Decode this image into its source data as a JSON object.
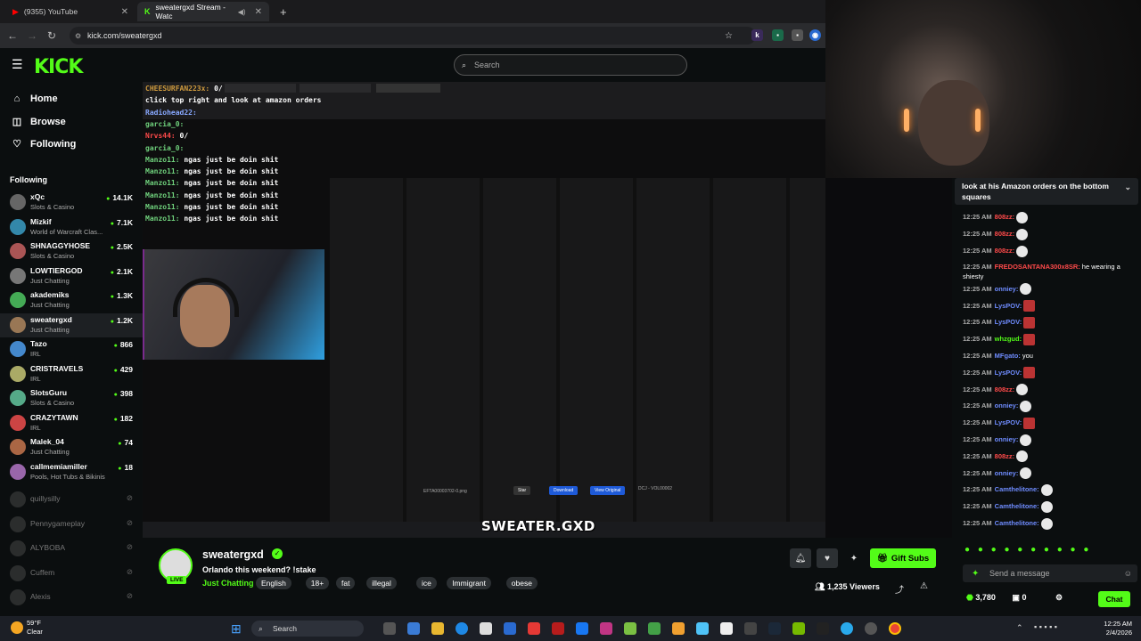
{
  "browser": {
    "tabs": [
      {
        "title": "(9355) YouTube"
      },
      {
        "title": "sweatergxd Stream - Watc"
      }
    ],
    "url": "kick.com/sweatergxd"
  },
  "header": {
    "logo": "KICK",
    "search_placeholder": "Search"
  },
  "sidebar": {
    "nav": [
      {
        "label": "Home"
      },
      {
        "label": "Browse"
      },
      {
        "label": "Following"
      }
    ],
    "following_title": "Following",
    "channels": [
      {
        "name": "xQc",
        "category": "Slots & Casino",
        "viewers": "14.1K"
      },
      {
        "name": "Mizkif",
        "category": "World of Warcraft Clas...",
        "viewers": "7.1K"
      },
      {
        "name": "SHNAGGYHOSE",
        "category": "Slots & Casino",
        "viewers": "2.5K"
      },
      {
        "name": "LOWTIERGOD",
        "category": "Just Chatting",
        "viewers": "2.1K"
      },
      {
        "name": "akademiks",
        "category": "Just Chatting",
        "viewers": "1.3K"
      },
      {
        "name": "sweatergxd",
        "category": "Just Chatting",
        "viewers": "1.2K"
      },
      {
        "name": "Tazo",
        "category": "IRL",
        "viewers": "866"
      },
      {
        "name": "CRISTRAVELS",
        "category": "IRL",
        "viewers": "429"
      },
      {
        "name": "SlotsGuru",
        "category": "Slots & Casino",
        "viewers": "398"
      },
      {
        "name": "CRAZYTAWN",
        "category": "IRL",
        "viewers": "182"
      },
      {
        "name": "Malek_04",
        "category": "Just Chatting",
        "viewers": "74"
      },
      {
        "name": "callmemiamiller",
        "category": "Pools, Hot Tubs & Bikinis",
        "viewers": "18"
      }
    ],
    "offline_channels": [
      {
        "name": "quillysilly"
      },
      {
        "name": "Pennygameplay"
      },
      {
        "name": "ALYBOBA"
      },
      {
        "name": "Cuffem"
      },
      {
        "name": "Alexis"
      }
    ]
  },
  "video": {
    "overlay_chat": [
      {
        "user": "CHEESURFAN223x:",
        "text": "0/"
      },
      {
        "user": "",
        "text": "click top right and look at amazon orders"
      },
      {
        "user": "Radiohead22:",
        "text": ""
      },
      {
        "user": "garcia_0:",
        "text": ""
      },
      {
        "user": "Nrvs44:",
        "text": "0/"
      },
      {
        "user": "garcia_0:",
        "text": ""
      },
      {
        "user": "Manzo11:",
        "text": "ngas just be doin shit"
      },
      {
        "user": "Manzo11:",
        "text": "ngas just be doin shit"
      },
      {
        "user": "Manzo11:",
        "text": "ngas just be doin shit"
      },
      {
        "user": "Manzo11:",
        "text": "ngas just be doin shit"
      },
      {
        "user": "Manzo11:",
        "text": "ngas just be doin shit"
      },
      {
        "user": "Manzo11:",
        "text": "ngas just be doin shit"
      }
    ],
    "inner_file": "EFTA00003702-0.png",
    "inner_buttons": [
      "Star",
      "Download",
      "View Original"
    ],
    "inner_code": "DCJ - VOL00002",
    "brand_text": "SWEATER.GXD"
  },
  "chat": {
    "pinned": "look at his Amazon orders on the bottom squares",
    "messages": [
      {
        "time": "12:25 AM",
        "user": "808zz:",
        "text": "",
        "color": "#ff4a4a"
      },
      {
        "time": "12:25 AM",
        "user": "808zz:",
        "text": "",
        "color": "#ff4a4a"
      },
      {
        "time": "12:25 AM",
        "user": "808zz:",
        "text": "",
        "color": "#ff4a4a"
      },
      {
        "time": "12:25 AM",
        "user": "FREDOSANTANA300x8SR:",
        "text": "he wearing a shiesty",
        "color": "#ff4a4a"
      },
      {
        "time": "12:25 AM",
        "user": "onniey:",
        "text": "",
        "color": "#6f8cff"
      },
      {
        "time": "12:25 AM",
        "user": "LysPOV:",
        "text": "",
        "color": "#6f8cff"
      },
      {
        "time": "12:25 AM",
        "user": "LysPOV:",
        "text": "",
        "color": "#6f8cff"
      },
      {
        "time": "12:25 AM",
        "user": "whzgud:",
        "text": "",
        "color": "#53fc18"
      },
      {
        "time": "12:25 AM",
        "user": "MFgato:",
        "text": "you",
        "color": "#6f8cff"
      },
      {
        "time": "12:25 AM",
        "user": "LysPOV:",
        "text": "",
        "color": "#6f8cff"
      },
      {
        "time": "12:25 AM",
        "user": "808zz:",
        "text": "",
        "color": "#ff4a4a"
      },
      {
        "time": "12:25 AM",
        "user": "onniey:",
        "text": "",
        "color": "#6f8cff"
      },
      {
        "time": "12:25 AM",
        "user": "LysPOV:",
        "text": "",
        "color": "#6f8cff"
      },
      {
        "time": "12:25 AM",
        "user": "onniey:",
        "text": "",
        "color": "#6f8cff"
      },
      {
        "time": "12:25 AM",
        "user": "808zz:",
        "text": "",
        "color": "#ff4a4a"
      },
      {
        "time": "12:25 AM",
        "user": "onniey:",
        "text": "",
        "color": "#6f8cff"
      },
      {
        "time": "12:25 AM",
        "user": "Camthelitone:",
        "text": "",
        "color": "#6f8cff"
      },
      {
        "time": "12:25 AM",
        "user": "Camthelitone:",
        "text": "",
        "color": "#6f8cff"
      },
      {
        "time": "12:25 AM",
        "user": "Camthelitone:",
        "text": "",
        "color": "#6f8cff"
      }
    ],
    "send_placeholder": "Send a message",
    "points": "3,780",
    "count": "0",
    "chat_button": "Chat"
  },
  "stream": {
    "streamer": "sweatergxd",
    "title": "Orlando this weekend? !stake",
    "category": "Just Chatting",
    "tags": [
      "English",
      "18+",
      "fat",
      "illegal",
      "ice",
      "Immigrant",
      "obese"
    ],
    "live": "LIVE",
    "gift_button": "Gift Subs",
    "viewers": "1,235 Viewers"
  },
  "taskbar": {
    "temp": "59°F",
    "condition": "Clear",
    "search": "Search",
    "time": "12:25 AM",
    "date": "2/4/2026"
  },
  "colors": {
    "accent": "#53fc18"
  }
}
